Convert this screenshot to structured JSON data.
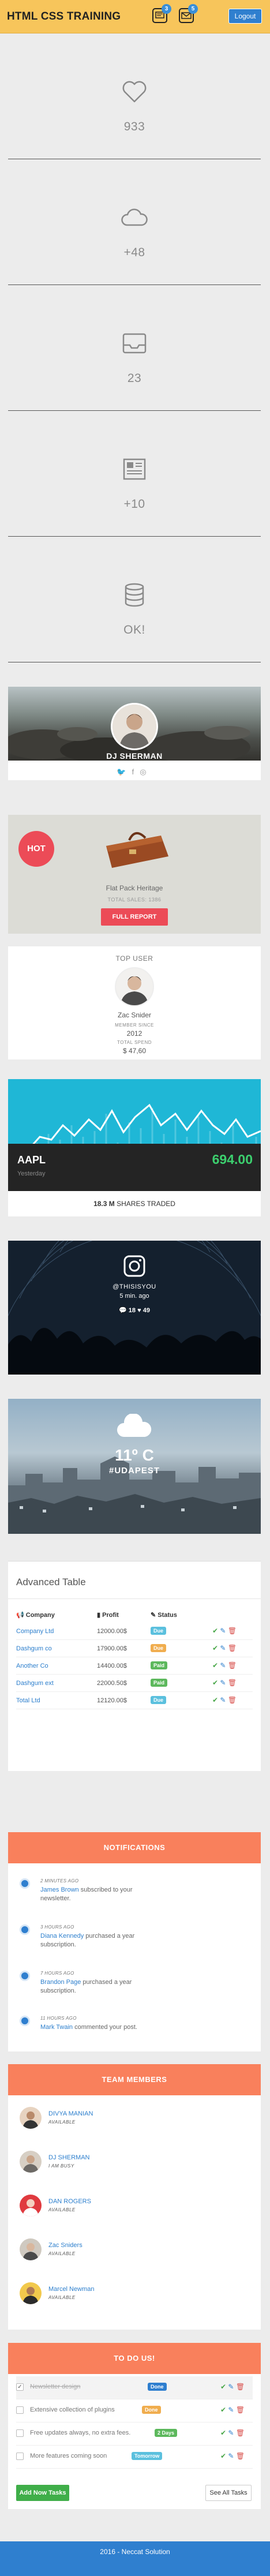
{
  "header": {
    "brand": "HTML CSS TRAINING",
    "messages_badge": "3",
    "mail_badge": "5",
    "logout_label": "Logout"
  },
  "stats": [
    {
      "icon": "heart-icon",
      "value": "933"
    },
    {
      "icon": "cloud-icon",
      "value": "+48"
    },
    {
      "icon": "inbox-icon",
      "value": "23"
    },
    {
      "icon": "newspaper-icon",
      "value": "+10"
    },
    {
      "icon": "database-icon",
      "value": "OK!"
    }
  ],
  "profile": {
    "name": "DJ SHERMAN",
    "social_icons": [
      "twitter-icon",
      "facebook-icon",
      "dribbble-icon"
    ]
  },
  "product": {
    "badge": "HOT",
    "title": "Flat Pack Heritage",
    "sales": "TOTAL SALES: 1386",
    "button": "FULL REPORT"
  },
  "top_user": {
    "heading": "TOP USER",
    "name": "Zac Snider",
    "member_since_label": "MEMBER SINCE",
    "member_since": "2012",
    "total_spend_label": "TOTAL SPEND",
    "total_spend": "$ 47,60"
  },
  "stock": {
    "symbol": "AAPL",
    "subtitle": "Yesterday",
    "price": "694.00",
    "traded_value": "18.3 M",
    "traded_label": "SHARES TRADED"
  },
  "instagram": {
    "handle": "@THISISYOU",
    "ago": "5 min. ago",
    "likes": "18",
    "hearts": "49"
  },
  "weather": {
    "temp": "11º C",
    "city": "#UDAPEST"
  },
  "table": {
    "title": "Advanced Table",
    "headers": [
      "Company",
      "Profit",
      "Status"
    ],
    "rows": [
      {
        "company": "Company Ltd",
        "profit": "12000.00$",
        "status": "Due",
        "color": "#5bc0de"
      },
      {
        "company": "Dashgum co",
        "profit": "17900.00$",
        "status": "Due",
        "color": "#f0ad4e"
      },
      {
        "company": "Another Co",
        "profit": "14400.00$",
        "status": "Paid",
        "color": "#5cb85c"
      },
      {
        "company": "Dashgum ext",
        "profit": "22000.50$",
        "status": "Paid",
        "color": "#5cb85c"
      },
      {
        "company": "Total Ltd",
        "profit": "12120.00$",
        "status": "Due",
        "color": "#5bc0de"
      }
    ]
  },
  "notifications": {
    "title": "NOTIFICATIONS",
    "items": [
      {
        "time": "2 MINUTES AGO",
        "name": "James Brown",
        "text": "subscribed to your newsletter."
      },
      {
        "time": "3 HOURS AGO",
        "name": "Diana Kennedy",
        "text": "purchased a year subscription."
      },
      {
        "time": "7 HOURS AGO",
        "name": "Brandon Page",
        "text": "purchased a year subscription."
      },
      {
        "time": "11 HOURS AGO",
        "name": "Mark Twain",
        "text": "commented your post."
      }
    ]
  },
  "team": {
    "title": "TEAM MEMBERS",
    "members": [
      {
        "name": "DIVYA MANIAN",
        "status": "AVAILABLE",
        "color": "#e7d3c0"
      },
      {
        "name": "DJ SHERMAN",
        "status": "I AM BUSY",
        "color": "#d7cfc4"
      },
      {
        "name": "DAN ROGERS",
        "status": "AVAILABLE",
        "color": "#e03a3f"
      },
      {
        "name": "Zac Sniders",
        "status": "AVAILABLE",
        "color": "#cfc9c0"
      },
      {
        "name": "Marcel Newman",
        "status": "AVAILABLE",
        "color": "#f2c94c"
      }
    ]
  },
  "todo": {
    "title": "TO DO US!",
    "items": [
      {
        "text": "Newsletter design",
        "badge": "Done",
        "color": "#2f7fcf",
        "done": true
      },
      {
        "text": "Extensive collection of plugins",
        "badge": "Done",
        "color": "#f0ad4e",
        "done": false
      },
      {
        "text": "Free updates always, no extra fees.",
        "badge": "2 Days",
        "color": "#5cb85c",
        "done": false
      },
      {
        "text": "More features coming soon",
        "badge": "Tomorrow",
        "color": "#5bc0de",
        "done": false
      }
    ],
    "add_label": "Add Now Tasks",
    "see_label": "See All Tasks"
  },
  "footer": {
    "text": "2016 - Neccat Solution"
  }
}
